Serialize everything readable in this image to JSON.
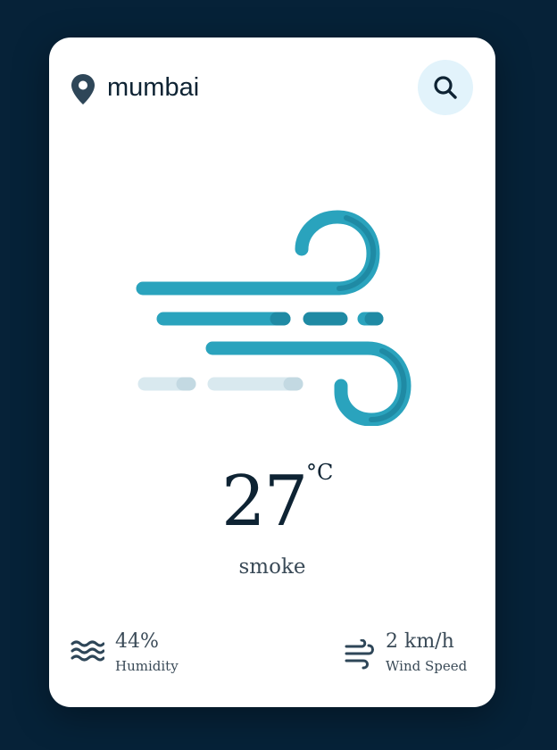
{
  "location": {
    "city": "mumbai",
    "icon": "map-pin-icon"
  },
  "search": {
    "icon": "search-icon"
  },
  "weather": {
    "icon": "wind-illustration",
    "temperature": "27",
    "unit": "°C",
    "description": "smoke"
  },
  "stats": {
    "humidity": {
      "icon": "waves-icon",
      "value": "44%",
      "label": "Humidity"
    },
    "wind": {
      "icon": "wind-icon",
      "value": "2 km/h",
      "label": "Wind Speed"
    }
  },
  "colors": {
    "background": "#062238",
    "card": "#ffffff",
    "accent": "#2aa3bd",
    "accent_dark": "#1f8aa4",
    "text": "#0e2333",
    "muted": "#3a4a57",
    "search_bg": "#e2f3fb"
  }
}
